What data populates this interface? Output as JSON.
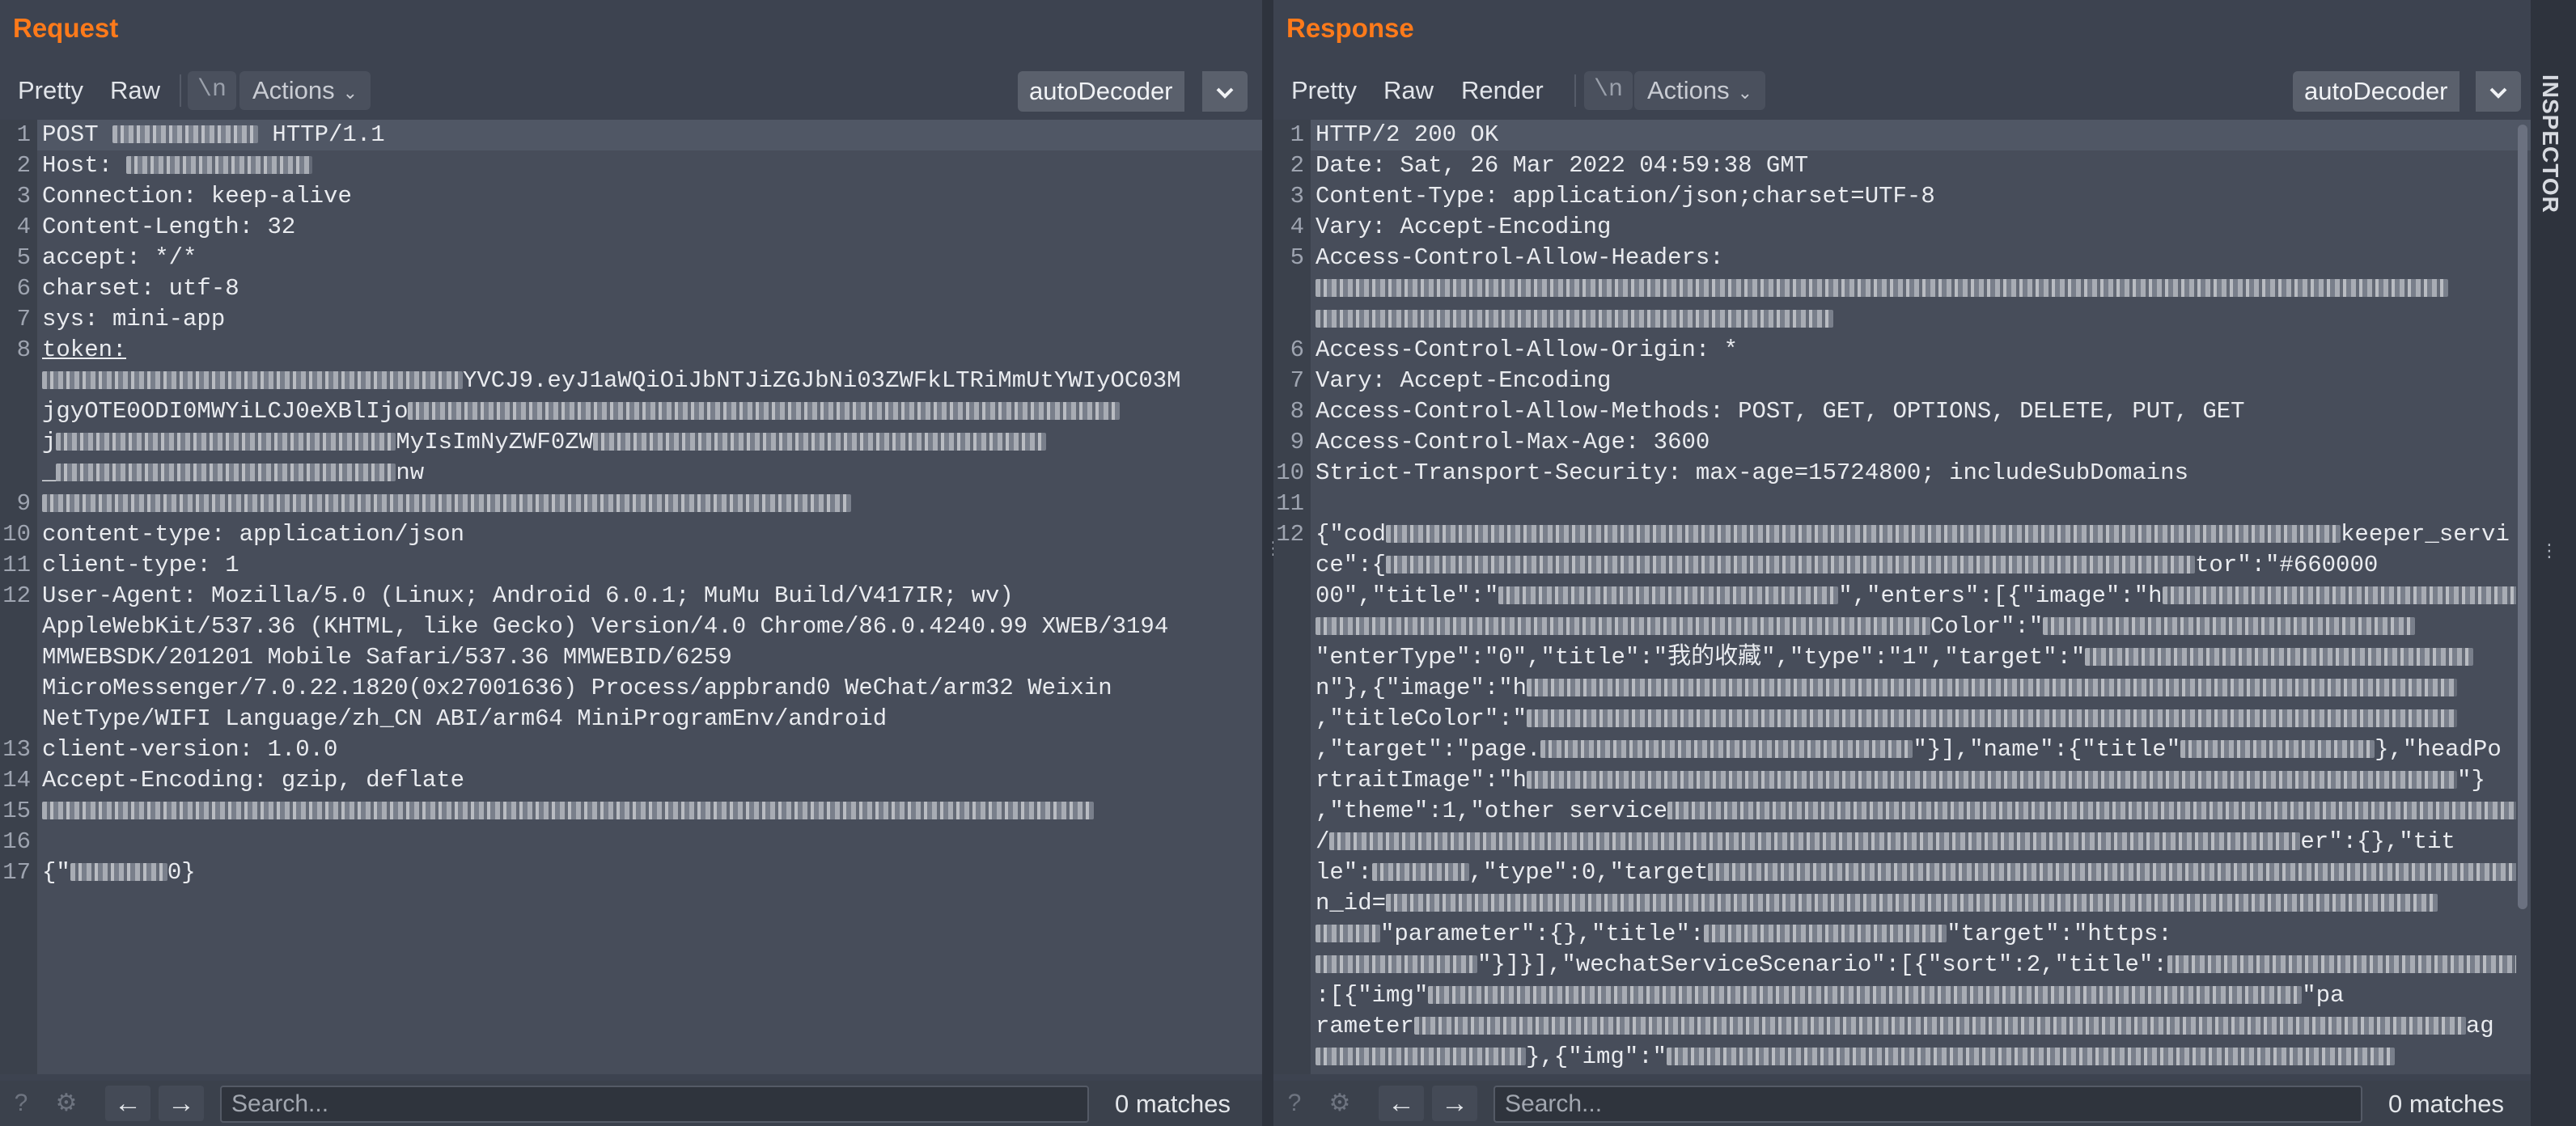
{
  "request": {
    "title": "Request",
    "toolbar": {
      "pretty": "Pretty",
      "raw": "Raw",
      "newline": "\\n",
      "actions": "Actions",
      "decoder": "autoDecoder"
    },
    "lines": [
      {
        "n": "1",
        "t": "POST ",
        "b1": 180,
        "t2": " HTTP/1.1"
      },
      {
        "n": "2",
        "t": "Host: ",
        "b1": 230,
        "t2": ""
      },
      {
        "n": "3",
        "t": "Connection: keep-alive",
        "b1": 0,
        "t2": ""
      },
      {
        "n": "4",
        "t": "Content-Length: 32",
        "b1": 0,
        "t2": ""
      },
      {
        "n": "5",
        "t": "accept: */*",
        "b1": 0,
        "t2": ""
      },
      {
        "n": "6",
        "t": "charset: utf-8",
        "b1": 0,
        "t2": ""
      },
      {
        "n": "7",
        "t": "sys: mini-app",
        "b1": 0,
        "t2": ""
      },
      {
        "n": "8",
        "t": "token:",
        "b1": 0,
        "t2": ""
      },
      {
        "n": "",
        "t": "",
        "b1": 520,
        "t2": "YVCJ9.eyJ1aWQiOiJbNTJiZGJbNi03ZWFkLTRiMmUtYWIyOC03M"
      },
      {
        "n": "",
        "t": "jgyOTE0ODI0MWYiLCJ0eXBlIjo",
        "b1": 880,
        "t2": ""
      },
      {
        "n": "",
        "t": "j",
        "b1": 420,
        "t2": "MyIsImNyZWF0ZW",
        "b2": 560
      },
      {
        "n": "",
        "t": "_",
        "b1": 420,
        "t2": "nw"
      },
      {
        "n": "9",
        "t": "",
        "b1": 1000,
        "t2": ""
      },
      {
        "n": "10",
        "t": "content-type: application/json",
        "b1": 0,
        "t2": ""
      },
      {
        "n": "11",
        "t": "client-type: 1",
        "b1": 0,
        "t2": ""
      },
      {
        "n": "12",
        "t": "User-Agent: Mozilla/5.0 (Linux; Android 6.0.1; MuMu Build/V417IR; wv)",
        "b1": 0,
        "t2": ""
      },
      {
        "n": "",
        "t": "AppleWebKit/537.36 (KHTML, like Gecko) Version/4.0 Chrome/86.0.4240.99 XWEB/3194",
        "b1": 0,
        "t2": ""
      },
      {
        "n": "",
        "t": "MMWEBSDK/201201 Mobile Safari/537.36 MMWEBID/6259",
        "b1": 0,
        "t2": ""
      },
      {
        "n": "",
        "t": "MicroMessenger/7.0.22.1820(0x27001636) Process/appbrand0 WeChat/arm32 Weixin",
        "b1": 0,
        "t2": ""
      },
      {
        "n": "",
        "t": "NetType/WIFI Language/zh_CN ABI/arm64 MiniProgramEnv/android",
        "b1": 0,
        "t2": ""
      },
      {
        "n": "13",
        "t": "client-version: 1.0.0",
        "b1": 0,
        "t2": ""
      },
      {
        "n": "14",
        "t": "Accept-Encoding: gzip, deflate",
        "b1": 0,
        "t2": ""
      },
      {
        "n": "15",
        "t": "",
        "b1": 1300,
        "t2": ""
      },
      {
        "n": "16",
        "t": "",
        "b1": 0,
        "t2": ""
      },
      {
        "n": "17",
        "t": "{\"",
        "b1": 120,
        "t2": "0}"
      }
    ],
    "search_placeholder": "Search...",
    "matches": "0 matches"
  },
  "response": {
    "title": "Response",
    "toolbar": {
      "pretty": "Pretty",
      "raw": "Raw",
      "render": "Render",
      "newline": "\\n",
      "actions": "Actions",
      "decoder": "autoDecoder"
    },
    "lines": [
      {
        "n": "1",
        "t": "HTTP/2 200 OK",
        "b1": 0,
        "t2": ""
      },
      {
        "n": "2",
        "t": "Date: Sat, 26 Mar 2022 04:59:38 GMT",
        "b1": 0,
        "t2": ""
      },
      {
        "n": "3",
        "t": "Content-Type: application/json;charset=UTF-8",
        "b1": 0,
        "t2": ""
      },
      {
        "n": "4",
        "t": "Vary: Accept-Encoding",
        "b1": 0,
        "t2": ""
      },
      {
        "n": "5",
        "t": "Access-Control-Allow-Headers:",
        "b1": 0,
        "t2": ""
      },
      {
        "n": "",
        "t": "",
        "b1": 1460,
        "t2": ""
      },
      {
        "n": "",
        "t": "",
        "b1": 640,
        "t2": ""
      },
      {
        "n": "6",
        "t": "Access-Control-Allow-Origin: *",
        "b1": 0,
        "t2": ""
      },
      {
        "n": "7",
        "t": "Vary: Accept-Encoding",
        "b1": 0,
        "t2": ""
      },
      {
        "n": "8",
        "t": "Access-Control-Allow-Methods: POST, GET, OPTIONS, DELETE, PUT, GET",
        "b1": 0,
        "t2": ""
      },
      {
        "n": "9",
        "t": "Access-Control-Max-Age: 3600",
        "b1": 0,
        "t2": ""
      },
      {
        "n": "10",
        "t": "Strict-Transport-Security: max-age=15724800; includeSubDomains",
        "b1": 0,
        "t2": ""
      },
      {
        "n": "11",
        "t": "",
        "b1": 0,
        "t2": ""
      },
      {
        "n": "12",
        "t": "{\"cod",
        "b1": 1180,
        "t2": "keeper_servi"
      },
      {
        "n": "",
        "t": "ce\":{",
        "b1": 1000,
        "t2": "tor\":\"#660000"
      },
      {
        "n": "",
        "t": "00\",\"title\":\"",
        "b1": 420,
        "t2": "\",\"enters\":[{\"image\":\"h",
        "b2": 460
      },
      {
        "n": "",
        "t": "",
        "b1": 760,
        "t2": "Color\":\"",
        "b2": 460
      },
      {
        "n": "",
        "t": "\"enterType\":\"0\",\"title\":\"我的收藏\",\"type\":\"1\",\"target\":\"",
        "b1": 480,
        "t2": ""
      },
      {
        "n": "",
        "t": "n\"},{\"image\":\"h",
        "b1": 1150,
        "t2": ""
      },
      {
        "n": "",
        "t": ",\"titleColor\":\"",
        "b1": 1150,
        "t2": ""
      },
      {
        "n": "",
        "t": ",\"target\":\"page.",
        "b1": 460,
        "t2": "\"}],\"name\":{\"title\"",
        "b2": 240,
        "t3": "},\"headPo"
      },
      {
        "n": "",
        "t": "rtraitImage\":\"h",
        "b1": 1150,
        "t2": "\"}"
      },
      {
        "n": "",
        "t": ",\"theme\":1,\"other service",
        "b1": 1050,
        "t2": ""
      },
      {
        "n": "",
        "t": "/",
        "b1": 1200,
        "t2": "er\":{},\"tit"
      },
      {
        "n": "",
        "t": "le\":",
        "b1": 120,
        "t2": ",\"type\":0,\"target",
        "b2": 1000
      },
      {
        "n": "",
        "t": "n_id=",
        "b1": 1300,
        "t2": ""
      },
      {
        "n": "",
        "t": "",
        "b1": 80,
        "t2": "\"parameter\":{},\"title\":",
        "b2": 300,
        "t3": "\"target\":\"https:"
      },
      {
        "n": "",
        "t": "",
        "b1": 200,
        "t2": "\"}]}],\"wechatServiceScenario\":[{\"sort\":2,\"title\":",
        "b2": 440
      },
      {
        "n": "",
        "t": ":[{\"img\"",
        "b1": 1080,
        "t2": "\"pa"
      },
      {
        "n": "",
        "t": "rameter",
        "b1": 1300,
        "t2": "ag"
      },
      {
        "n": "",
        "t": "",
        "b1": 260,
        "t2": "},{\"img\":\"",
        "b2": 900
      }
    ],
    "search_placeholder": "Search...",
    "matches": "0 matches"
  },
  "inspector": {
    "label": "INSPECTOR"
  },
  "icons": {
    "help": "help-icon",
    "settings": "gear-icon",
    "back": "arrow-left-icon",
    "forward": "arrow-right-icon",
    "chevron": "chevron-down-icon"
  }
}
